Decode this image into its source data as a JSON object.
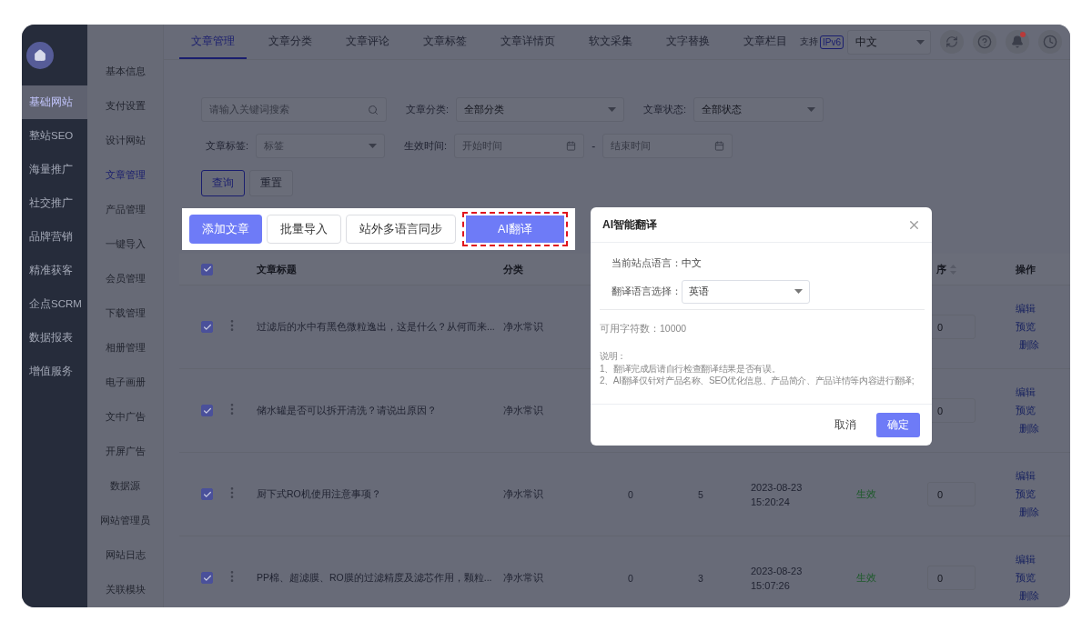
{
  "sidebar": {
    "items": [
      {
        "label": "基础网站",
        "selected": true
      },
      {
        "label": "整站SEO",
        "selected": false
      },
      {
        "label": "海量推广",
        "selected": false
      },
      {
        "label": "社交推广",
        "selected": false
      },
      {
        "label": "品牌营销",
        "selected": false
      },
      {
        "label": "精准获客",
        "selected": false
      },
      {
        "label": "企点SCRM",
        "selected": false
      },
      {
        "label": "数据报表",
        "selected": false
      },
      {
        "label": "增值服务",
        "selected": false
      }
    ]
  },
  "subnav": {
    "items": [
      {
        "label": "基本信息",
        "selected": false
      },
      {
        "label": "支付设置",
        "selected": false
      },
      {
        "label": "设计网站",
        "selected": false
      },
      {
        "label": "文章管理",
        "selected": true
      },
      {
        "label": "产品管理",
        "selected": false
      },
      {
        "label": "一键导入",
        "selected": false
      },
      {
        "label": "会员管理",
        "selected": false
      },
      {
        "label": "下载管理",
        "selected": false
      },
      {
        "label": "相册管理",
        "selected": false
      },
      {
        "label": "电子画册",
        "selected": false
      },
      {
        "label": "文中广告",
        "selected": false
      },
      {
        "label": "开屏广告",
        "selected": false
      },
      {
        "label": "数据源",
        "selected": false
      },
      {
        "label": "网站管理员",
        "selected": false
      },
      {
        "label": "网站日志",
        "selected": false
      },
      {
        "label": "关联模块",
        "selected": false
      }
    ]
  },
  "tabs": [
    {
      "label": "文章管理",
      "selected": true
    },
    {
      "label": "文章分类",
      "selected": false
    },
    {
      "label": "文章评论",
      "selected": false
    },
    {
      "label": "文章标签",
      "selected": false
    },
    {
      "label": "文章详情页",
      "selected": false
    },
    {
      "label": "软文采集",
      "selected": false
    },
    {
      "label": "文字替换",
      "selected": false
    },
    {
      "label": "文章栏目",
      "selected": false
    }
  ],
  "ipv6": {
    "text": "支持",
    "badge": "IPv6"
  },
  "language_select": {
    "value": "中文"
  },
  "notifications": {
    "unread": true
  },
  "filters": {
    "search": {
      "placeholder": "请输入关键词搜索"
    },
    "category": {
      "label": "文章分类:",
      "value": "全部分类"
    },
    "status": {
      "label": "文章状态:",
      "value": "全部状态"
    },
    "tag": {
      "label": "文章标签:",
      "placeholder": "标签"
    },
    "time": {
      "label": "生效时间:",
      "start_placeholder": "开始时间",
      "separator": "-",
      "end_placeholder": "结束时间"
    },
    "buttons": [
      {
        "label": "查询",
        "kind": "outline"
      },
      {
        "label": "重置",
        "kind": "default"
      }
    ]
  },
  "toolbar": {
    "buttons": [
      {
        "label": "添加文章",
        "kind": "primary",
        "highlighted": false
      },
      {
        "label": "批量导入",
        "kind": "default",
        "highlighted": false
      },
      {
        "label": "站外多语言同步",
        "kind": "default",
        "highlighted": false
      },
      {
        "label": "AI翻译",
        "kind": "primary",
        "highlighted": true
      }
    ]
  },
  "table": {
    "header_checked": true,
    "columns": {
      "title": "文章标题",
      "category": "分类",
      "sort": "序",
      "actions": "操作"
    },
    "rows": [
      {
        "checked": true,
        "title": "过滤后的水中有黑色微粒逸出，这是什么？从何而来...",
        "category": "净水常识",
        "sort": "0",
        "actions": [
          "编辑",
          "预览",
          "删除"
        ]
      },
      {
        "checked": true,
        "title": "储水罐是否可以拆开清洗？请说出原因？",
        "category": "净水常识",
        "sort": "0",
        "actions": [
          "编辑",
          "预览",
          "删除"
        ]
      },
      {
        "checked": true,
        "title": "厨下式RO机使用注意事项？",
        "category": "净水常识",
        "column_3": "0",
        "column_4": "5",
        "date": "2023-08-23",
        "time": "15:20:24",
        "status": {
          "label": "生效",
          "color": "#1d5a2a"
        },
        "sort": "0",
        "actions": [
          "编辑",
          "预览",
          "删除"
        ]
      },
      {
        "checked": true,
        "title": "PP棉、超滤膜、RO膜的过滤精度及滤芯作用，颗粒...",
        "category": "净水常识",
        "column_3": "0",
        "column_4": "3",
        "date": "2023-08-23",
        "time": "15:07:26",
        "status": {
          "label": "生效",
          "color": "#1d5a2a"
        },
        "sort": "0",
        "actions": [
          "编辑",
          "预览",
          "删除"
        ]
      }
    ]
  },
  "modal": {
    "title": "AI智能翻译",
    "current_language": {
      "label": "当前站点语言：",
      "value": "中文"
    },
    "target_language": {
      "label": "翻译语言选择：",
      "value": "英语"
    },
    "quota": "可用字符数：10000",
    "notes": [
      "说明：",
      "1、翻译完成后请自行检查翻译结果是否有误。",
      "2、AI翻译仅针对产品名称、SEO优化信息、产品简介、产品详情等内容进行翻译;"
    ],
    "buttons": [
      {
        "label": "取消",
        "kind": "text"
      },
      {
        "label": "确定",
        "kind": "primary"
      }
    ]
  }
}
